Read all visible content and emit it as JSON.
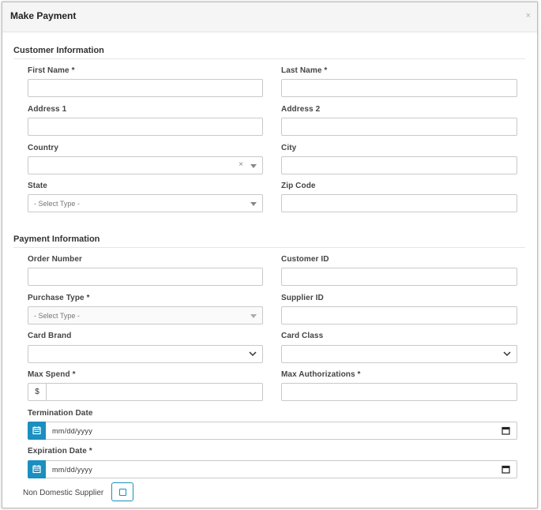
{
  "modal": {
    "title": "Make Payment",
    "close": "×"
  },
  "customer": {
    "section_title": "Customer Information",
    "first_name": {
      "label": "First Name *",
      "value": ""
    },
    "last_name": {
      "label": "Last Name *",
      "value": ""
    },
    "address1": {
      "label": "Address 1",
      "value": ""
    },
    "address2": {
      "label": "Address 2",
      "value": ""
    },
    "country": {
      "label": "Country",
      "value": "",
      "clear": "×"
    },
    "city": {
      "label": "City",
      "value": ""
    },
    "state": {
      "label": "State",
      "placeholder": "- Select Type -"
    },
    "zip": {
      "label": "Zip Code",
      "value": ""
    }
  },
  "payment": {
    "section_title": "Payment Information",
    "order_number": {
      "label": "Order Number",
      "value": ""
    },
    "customer_id": {
      "label": "Customer ID",
      "value": ""
    },
    "purchase_type": {
      "label": "Purchase Type *",
      "placeholder": "- Select Type -"
    },
    "supplier_id": {
      "label": "Supplier ID",
      "value": ""
    },
    "card_brand": {
      "label": "Card Brand",
      "value": ""
    },
    "card_class": {
      "label": "Card Class",
      "value": ""
    },
    "max_spend": {
      "label": "Max Spend *",
      "currency": "$",
      "value": ""
    },
    "max_auth": {
      "label": "Max Authorizations *",
      "value": ""
    },
    "termination_date": {
      "label": "Termination Date",
      "placeholder": "mm/dd/yyyy"
    },
    "expiration_date": {
      "label": "Expiration Date *",
      "placeholder": "mm/dd/yyyy"
    },
    "non_domestic": {
      "label": "Non Domestic Supplier",
      "checked": false
    }
  },
  "colors": {
    "accent": "#1a8fc0",
    "border": "#c9c9c9",
    "header_bg": "#f5f5f5"
  },
  "icons": {
    "calendar": "calendar-icon",
    "chevron": "chevron-down-icon",
    "caret": "caret-down-icon",
    "close": "close-icon"
  }
}
